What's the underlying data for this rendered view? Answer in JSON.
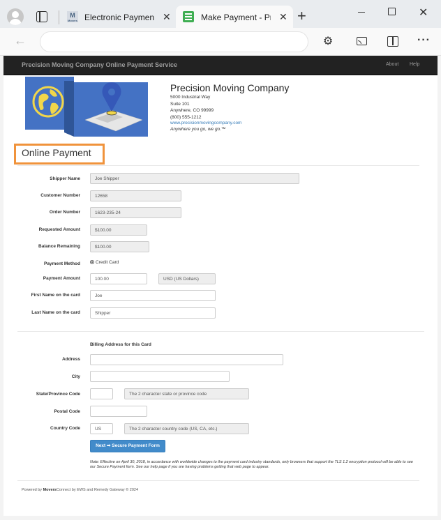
{
  "browser": {
    "tabs": [
      {
        "title": "Electronic Payment",
        "favicon_text": "M",
        "favicon_sub": "Movers"
      },
      {
        "title": "Make Payment - Pr",
        "active": true
      }
    ],
    "new_tab": "+",
    "window_controls": {
      "minimize": "minimize",
      "maximize": "maximize",
      "close": "✕"
    },
    "nav": {
      "back": "←",
      "url": ""
    },
    "toolbar_icons": [
      "extensions-icon",
      "cast-icon",
      "split-screen-icon",
      "more-icon"
    ]
  },
  "navbar": {
    "brand": "Precision Moving Company Online Payment Service",
    "links": [
      {
        "label": "About"
      },
      {
        "label": "Help"
      }
    ]
  },
  "company": {
    "name": "Precision Moving Company",
    "address1": "5000 Industrial Way",
    "address2": "Suite 101",
    "city_line": "Anywhere, CO 99999",
    "phone": "(800) 555-1212",
    "website": "www.precisionmovingcompany.com",
    "tagline": "Anywhere you go, we go.™"
  },
  "page_title": "Online Payment",
  "form": {
    "shipper_name": {
      "label": "Shipper Name",
      "value": "Joe Shipper"
    },
    "customer_number": {
      "label": "Customer Number",
      "value": "12658"
    },
    "order_number": {
      "label": "Order Number",
      "value": "1623-235-24"
    },
    "requested_amount": {
      "label": "Requested Amount",
      "value": "$100.00"
    },
    "balance_remaining": {
      "label": "Balance Remaining",
      "value": "$100.00"
    },
    "payment_method": {
      "label": "Payment Method",
      "value": "Credit Card"
    },
    "payment_amount": {
      "label": "Payment Amount",
      "value": "100.00",
      "currency": "USD (US Dollars)"
    },
    "first_name": {
      "label": "First Name on the card",
      "value": "Joe"
    },
    "last_name": {
      "label": "Last Name on the card",
      "value": "Shipper"
    }
  },
  "billing": {
    "heading": "Billing Address for this Card",
    "address": {
      "label": "Address",
      "value": ""
    },
    "city": {
      "label": "City",
      "value": ""
    },
    "state": {
      "label": "State/Province Code",
      "value": "",
      "hint": "The 2 character state or province code"
    },
    "postal": {
      "label": "Postal Code",
      "value": ""
    },
    "country": {
      "label": "Country Code",
      "value": "US",
      "hint": "The 2 character country code (US, CA, etc.)"
    }
  },
  "submit_label": "Next ➡ Secure Payment Form",
  "note": "Note: Effective on April 30, 2018, in accordance with worldwide changes to the payment card industry standards, only browsers that support the TLS 1.2 encryption protocol will be able to see our Secure Payment form. See our help page if you are having problems getting that web page to appear.",
  "footer": {
    "prefix": "Powered by ",
    "brand": "Movers",
    "suffix": "Connect by EWS and Remedy Gateway © 2024"
  },
  "colors": {
    "navbar": "#222222",
    "accent_box": "#f0933c",
    "button": "#428bca",
    "logo_blue": "#4472c4",
    "globe_yellow": "#f1d64a"
  }
}
